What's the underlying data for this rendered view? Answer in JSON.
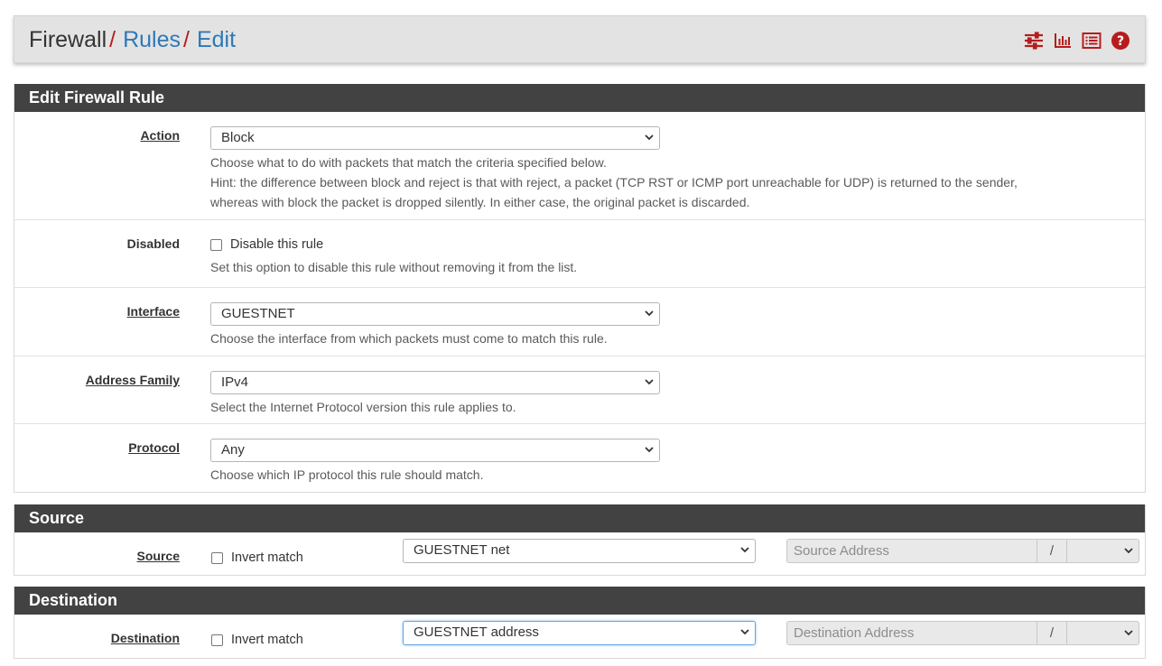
{
  "breadcrumb": {
    "root": "Firewall",
    "sep": "/",
    "rules": "Rules",
    "edit": "Edit"
  },
  "header_icons": [
    "sliders-icon",
    "bar-chart-icon",
    "list-icon",
    "help-circle-icon"
  ],
  "colors": {
    "accent_red": "#b71c1c",
    "link_blue": "#2f78b8",
    "panel_heading": "#424242"
  },
  "edit_rule": {
    "heading": "Edit Firewall Rule",
    "action": {
      "label": "Action",
      "value": "Block",
      "help1": "Choose what to do with packets that match the criteria specified below.",
      "help2": "Hint: the difference between block and reject is that with reject, a packet (TCP RST or ICMP port unreachable for UDP) is returned to the sender,",
      "help3": "whereas with block the packet is dropped silently. In either case, the original packet is discarded."
    },
    "disabled": {
      "label": "Disabled",
      "checkbox_label": "Disable this rule",
      "help": "Set this option to disable this rule without removing it from the list."
    },
    "interface": {
      "label": "Interface",
      "value": "GUESTNET",
      "help": "Choose the interface from which packets must come to match this rule."
    },
    "address_family": {
      "label": "Address Family",
      "value": "IPv4",
      "help": "Select the Internet Protocol version this rule applies to."
    },
    "protocol": {
      "label": "Protocol",
      "value": "Any",
      "help": "Choose which IP protocol this rule should match."
    }
  },
  "source": {
    "heading": "Source",
    "label": "Source",
    "invert_label": "Invert match",
    "network": "GUESTNET net",
    "address_placeholder": "Source Address",
    "slash": "/"
  },
  "destination": {
    "heading": "Destination",
    "label": "Destination",
    "invert_label": "Invert match",
    "network": "GUESTNET address",
    "address_placeholder": "Destination Address",
    "slash": "/"
  }
}
